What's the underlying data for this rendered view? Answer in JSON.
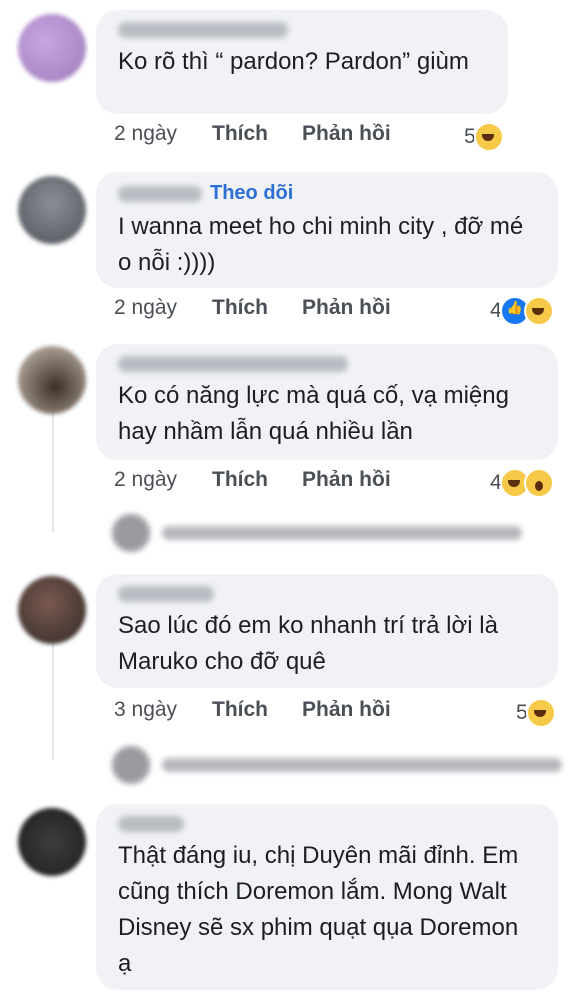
{
  "comments": [
    {
      "text": "Ko rõ thì “ pardon? Pardon” giùm",
      "time": "2 ngày",
      "like": "Thích",
      "reply": "Phản hồi",
      "reactions": "5"
    },
    {
      "follow": "Theo dõi",
      "text": "I wanna meet ho chi minh city , đỡ mé o nỗi :))))",
      "time": "2 ngày",
      "like": "Thích",
      "reply": "Phản hồi",
      "reactions": "4"
    },
    {
      "text": "Ko có năng lực mà quá cố, vạ miệng hay nhầm lẫn quá nhiều lần",
      "time": "2 ngày",
      "like": "Thích",
      "reply": "Phản hồi",
      "reactions": "4"
    },
    {
      "text": "Sao lúc đó em ko nhanh trí trả lời là Maruko cho đỡ quê",
      "time": "3 ngày",
      "like": "Thích",
      "reply": "Phản hồi",
      "reactions": "5"
    },
    {
      "text": "Thật đáng iu, chị Duyên mãi đỉnh. Em cũng thích Doremon lắm. Mong Walt Disney sẽ sx phim quạt qụa Doremon ạ"
    }
  ],
  "colors": {
    "bubble": "#f0f2f5",
    "link": "#2d6fd6",
    "meta": "#4b4f56"
  },
  "icons": [
    "haha-reaction-icon",
    "like-reaction-icon",
    "wow-reaction-icon"
  ]
}
